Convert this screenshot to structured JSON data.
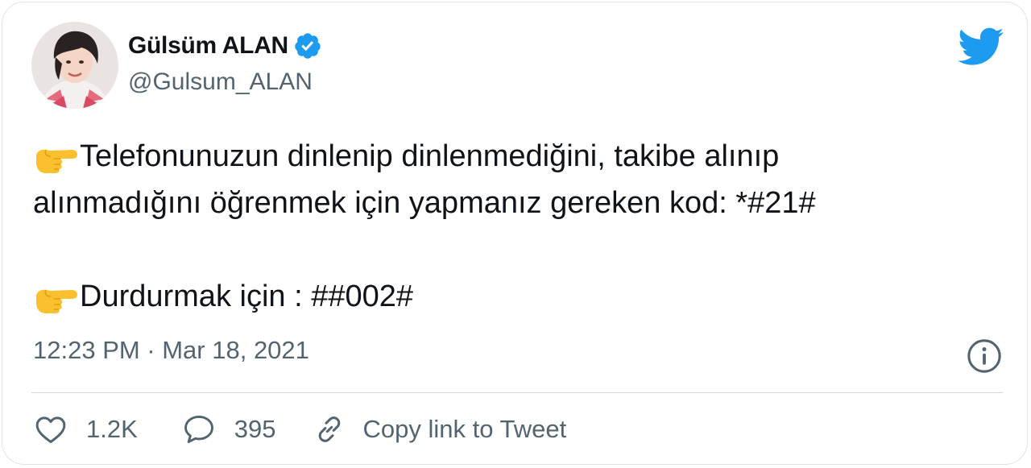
{
  "user": {
    "name": "Gülsüm ALAN",
    "handle": "@Gulsum_ALAN",
    "verified": true
  },
  "tweet": {
    "emoji": "backhand-index-pointing-right",
    "line1": "Telefonunuzun dinlenip dinlenmediğini, takibe alınıp",
    "line2": "alınmadığını öğrenmek için yapmanız gereken kod: *#21#",
    "line3": "Durdurmak için : ##002#"
  },
  "timestamp": "12:23 PM · Mar 18, 2021",
  "actions": {
    "likes": "1.2K",
    "replies": "395",
    "copy_link": "Copy link to Tweet"
  },
  "colors": {
    "twitter_blue": "#1d9bf0",
    "text_primary": "#0f1419",
    "text_secondary": "#536471",
    "divider": "#cfd9de"
  },
  "icons": [
    "twitter-bird-icon",
    "verified-badge-icon",
    "info-icon",
    "heart-icon",
    "reply-bubble-icon",
    "link-icon",
    "pointing-right-emoji-icon"
  ]
}
